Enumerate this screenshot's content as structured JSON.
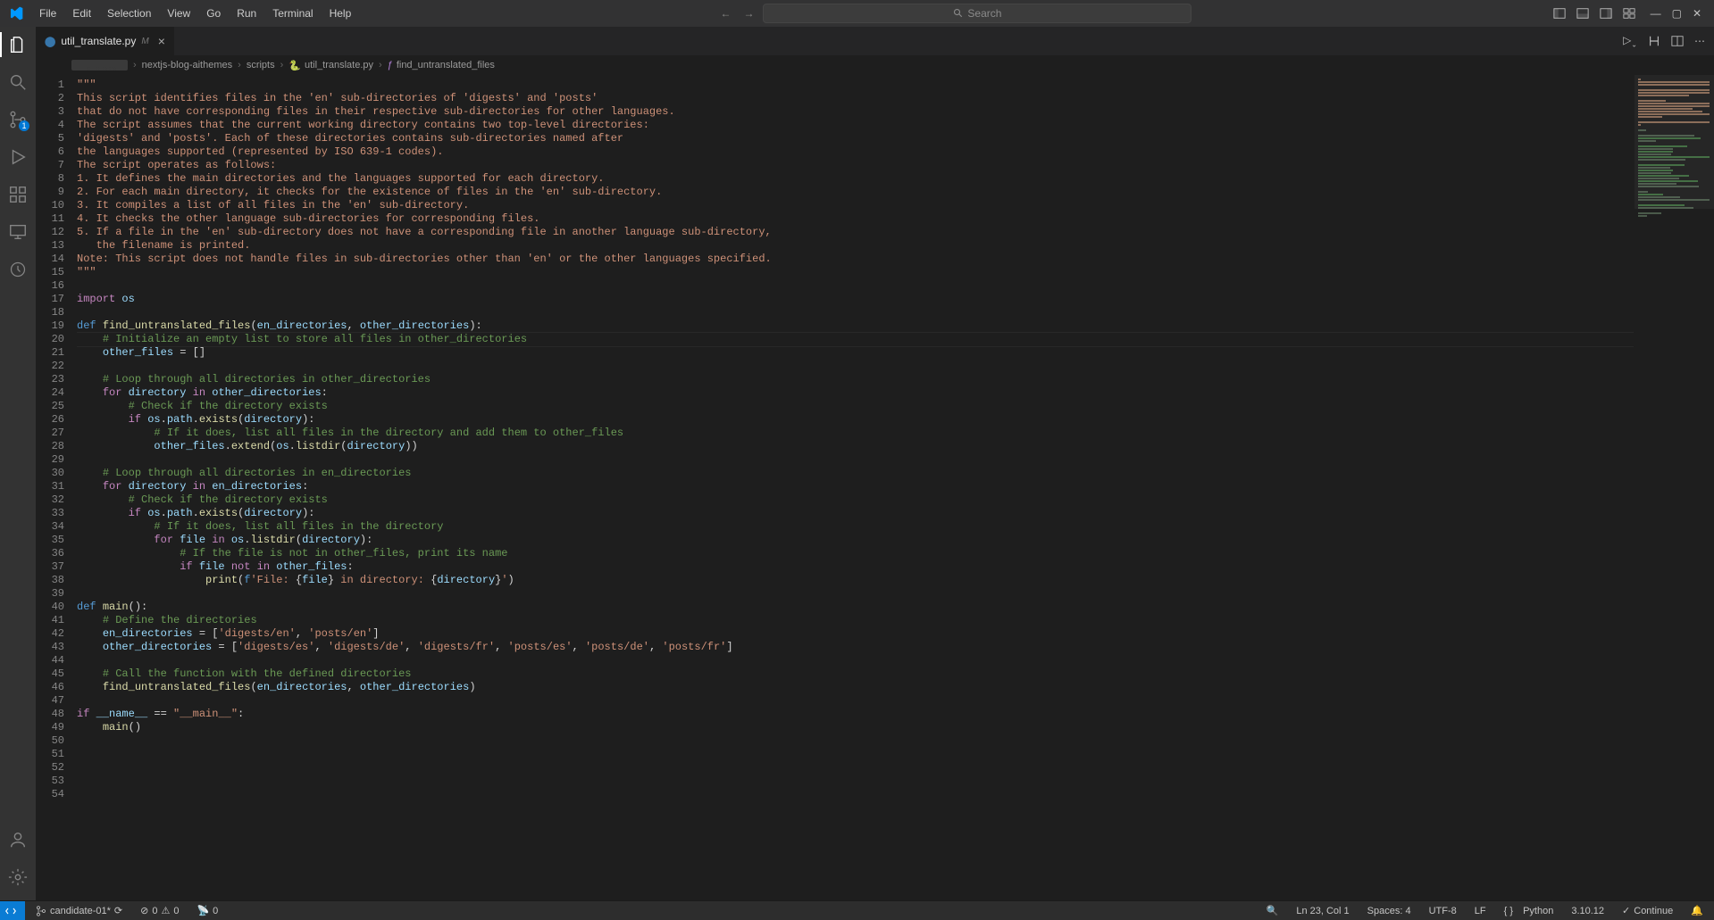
{
  "menu": [
    "File",
    "Edit",
    "Selection",
    "View",
    "Go",
    "Run",
    "Terminal",
    "Help"
  ],
  "search_placeholder": "Search",
  "tab": {
    "name": "util_translate.py",
    "modified_badge": "M"
  },
  "breadcrumbs": {
    "folder_redacted": "░░░░░",
    "items": [
      "nextjs-blog-aithemes",
      "scripts",
      "util_translate.py",
      "find_untranslated_files"
    ]
  },
  "activity_badge": "1",
  "status": {
    "remote": "candidate-01*",
    "problems_err": "0",
    "problems_warn": "0",
    "ports": "0",
    "cursor": "Ln 23, Col 1",
    "spaces": "Spaces: 4",
    "encoding": "UTF-8",
    "eol": "LF",
    "lang_sym": "{ }",
    "lang": "Python",
    "interpreter": "3.10.12",
    "copilot": "Continue"
  },
  "code_lines": [
    {
      "n": 1,
      "raw": "\"\"\"",
      "type": "str"
    },
    {
      "n": 2,
      "raw": "This script identifies files in the 'en' sub-directories of 'digests' and 'posts'",
      "type": "str"
    },
    {
      "n": 3,
      "raw": "that do not have corresponding files in their respective sub-directories for other languages.",
      "type": "str"
    },
    {
      "n": 4,
      "raw": "",
      "type": "str"
    },
    {
      "n": 5,
      "raw": "The script assumes that the current working directory contains two top-level directories:",
      "type": "str"
    },
    {
      "n": 6,
      "raw": "'digests' and 'posts'. Each of these directories contains sub-directories named after",
      "type": "str"
    },
    {
      "n": 7,
      "raw": "the languages supported (represented by ISO 639-1 codes).",
      "type": "str"
    },
    {
      "n": 8,
      "raw": "",
      "type": "str"
    },
    {
      "n": 9,
      "raw": "The script operates as follows:",
      "type": "str"
    },
    {
      "n": 10,
      "raw": "1. It defines the main directories and the languages supported for each directory.",
      "type": "str"
    },
    {
      "n": 11,
      "raw": "2. For each main directory, it checks for the existence of files in the 'en' sub-directory.",
      "type": "str"
    },
    {
      "n": 12,
      "raw": "3. It compiles a list of all files in the 'en' sub-directory.",
      "type": "str"
    },
    {
      "n": 13,
      "raw": "4. It checks the other language sub-directories for corresponding files.",
      "type": "str"
    },
    {
      "n": 14,
      "raw": "5. If a file in the 'en' sub-directory does not have a corresponding file in another language sub-directory,",
      "type": "str"
    },
    {
      "n": 15,
      "raw": "   the filename is printed.",
      "type": "str"
    },
    {
      "n": 16,
      "raw": "",
      "type": "str"
    },
    {
      "n": 17,
      "raw": "Note: This script does not handle files in sub-directories other than 'en' or the other languages specified.",
      "type": "str"
    },
    {
      "n": 18,
      "raw": "\"\"\"",
      "type": "str"
    },
    {
      "n": 19,
      "raw": "",
      "type": "blank"
    },
    {
      "n": 20,
      "raw": "import os",
      "type": "import"
    },
    {
      "n": 21,
      "raw": "",
      "type": "blank"
    },
    {
      "n": 22,
      "raw": "def find_untranslated_files(en_directories, other_directories):",
      "type": "def"
    },
    {
      "n": 23,
      "raw": "    # Initialize an empty list to store all files in other_directories",
      "type": "com",
      "current": true
    },
    {
      "n": 24,
      "raw": "    other_files = []",
      "type": "code"
    },
    {
      "n": 25,
      "raw": "",
      "type": "blank"
    },
    {
      "n": 26,
      "raw": "    # Loop through all directories in other_directories",
      "type": "com"
    },
    {
      "n": 27,
      "raw": "    for directory in other_directories:",
      "type": "for"
    },
    {
      "n": 28,
      "raw": "        # Check if the directory exists",
      "type": "com"
    },
    {
      "n": 29,
      "raw": "        if os.path.exists(directory):",
      "type": "if"
    },
    {
      "n": 30,
      "raw": "            # If it does, list all files in the directory and add them to other_files",
      "type": "com"
    },
    {
      "n": 31,
      "raw": "            other_files.extend(os.listdir(directory))",
      "type": "code2"
    },
    {
      "n": 32,
      "raw": "",
      "type": "blank"
    },
    {
      "n": 33,
      "raw": "    # Loop through all directories in en_directories",
      "type": "com"
    },
    {
      "n": 34,
      "raw": "    for directory in en_directories:",
      "type": "for"
    },
    {
      "n": 35,
      "raw": "        # Check if the directory exists",
      "type": "com"
    },
    {
      "n": 36,
      "raw": "        if os.path.exists(directory):",
      "type": "if"
    },
    {
      "n": 37,
      "raw": "            # If it does, list all files in the directory",
      "type": "com"
    },
    {
      "n": 38,
      "raw": "            for file in os.listdir(directory):",
      "type": "for2"
    },
    {
      "n": 39,
      "raw": "                # If the file is not in other_files, print its name",
      "type": "com"
    },
    {
      "n": 40,
      "raw": "                if file not in other_files:",
      "type": "if2"
    },
    {
      "n": 41,
      "raw": "                    print(f'File: {file} in directory: {directory}')",
      "type": "print"
    },
    {
      "n": 42,
      "raw": "",
      "type": "blank"
    },
    {
      "n": 43,
      "raw": "def main():",
      "type": "def2"
    },
    {
      "n": 44,
      "raw": "    # Define the directories",
      "type": "com"
    },
    {
      "n": 45,
      "raw": "    en_directories = ['digests/en', 'posts/en']",
      "type": "arr"
    },
    {
      "n": 46,
      "raw": "    other_directories = ['digests/es', 'digests/de', 'digests/fr', 'posts/es', 'posts/de', 'posts/fr']",
      "type": "arr"
    },
    {
      "n": 47,
      "raw": "",
      "type": "blank"
    },
    {
      "n": 48,
      "raw": "    # Call the function with the defined directories",
      "type": "com"
    },
    {
      "n": 49,
      "raw": "    find_untranslated_files(en_directories, other_directories)",
      "type": "call"
    },
    {
      "n": 50,
      "raw": "",
      "type": "blank"
    },
    {
      "n": 51,
      "raw": "if __name__ == \"__main__\":",
      "type": "ifmain"
    },
    {
      "n": 52,
      "raw": "    main()",
      "type": "call2"
    },
    {
      "n": 53,
      "raw": "",
      "type": "blank"
    },
    {
      "n": 54,
      "raw": "",
      "type": "blank"
    }
  ]
}
